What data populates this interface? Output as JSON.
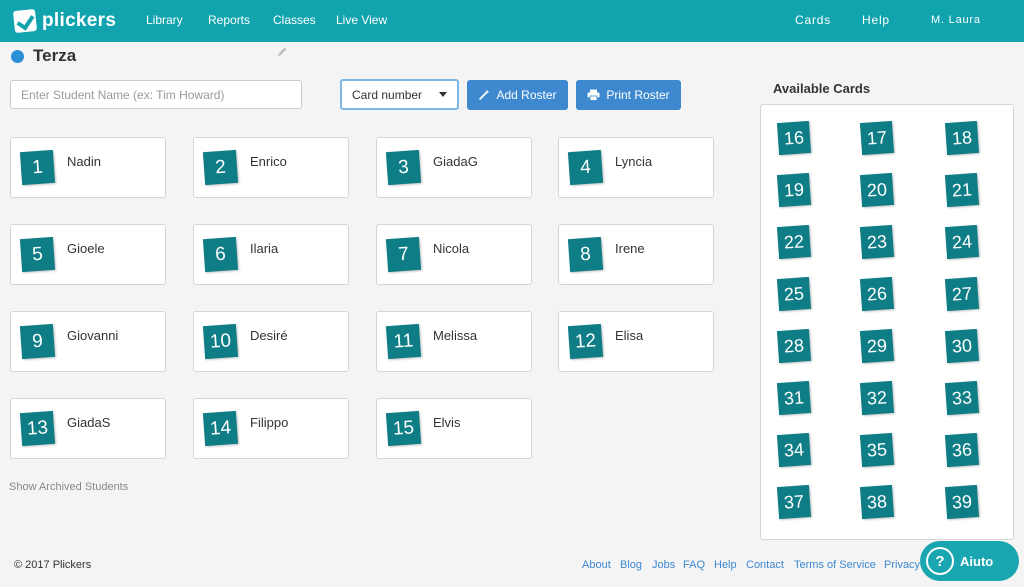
{
  "app": {
    "logo_text": "plickers"
  },
  "nav": {
    "library": "Library",
    "reports": "Reports",
    "classes": "Classes",
    "live_view": "Live View",
    "cards": "Cards",
    "help": "Help",
    "user": "M. Laura"
  },
  "class_name": "Terza",
  "controls": {
    "student_placeholder": "Enter Student Name (ex: Tim Howard)",
    "sort_select": "Card number",
    "add_roster": "Add Roster",
    "print_roster": "Print Roster"
  },
  "students": [
    {
      "num": "1",
      "name": "Nadin"
    },
    {
      "num": "2",
      "name": "Enrico"
    },
    {
      "num": "3",
      "name": "GiadaG"
    },
    {
      "num": "4",
      "name": "Lyncia"
    },
    {
      "num": "5",
      "name": "Gioele"
    },
    {
      "num": "6",
      "name": "Ilaria"
    },
    {
      "num": "7",
      "name": "Nicola"
    },
    {
      "num": "8",
      "name": "Irene"
    },
    {
      "num": "9",
      "name": "Giovanni"
    },
    {
      "num": "10",
      "name": "Desiré"
    },
    {
      "num": "11",
      "name": "Melissa"
    },
    {
      "num": "12",
      "name": "Elisa"
    },
    {
      "num": "13",
      "name": "GiadaS"
    },
    {
      "num": "14",
      "name": "Filippo"
    },
    {
      "num": "15",
      "name": "Elvis"
    }
  ],
  "archived_link": "Show Archived Students",
  "available": {
    "title": "Available Cards",
    "cards": [
      "16",
      "17",
      "18",
      "19",
      "20",
      "21",
      "22",
      "23",
      "24",
      "25",
      "26",
      "27",
      "28",
      "29",
      "30",
      "31",
      "32",
      "33",
      "34",
      "35",
      "36",
      "37",
      "38",
      "39"
    ]
  },
  "footer": {
    "copyright": "© 2017 Plickers",
    "links": [
      "About",
      "Blog",
      "Jobs",
      "FAQ",
      "Help",
      "Contact",
      "Terms of Service",
      "Privacy"
    ],
    "help_button": "Aiuto",
    "help_icon_glyph": "?"
  },
  "colors": {
    "teal": "#12a4ae",
    "card": "#0e7d86",
    "button_blue": "#3d88cf"
  }
}
